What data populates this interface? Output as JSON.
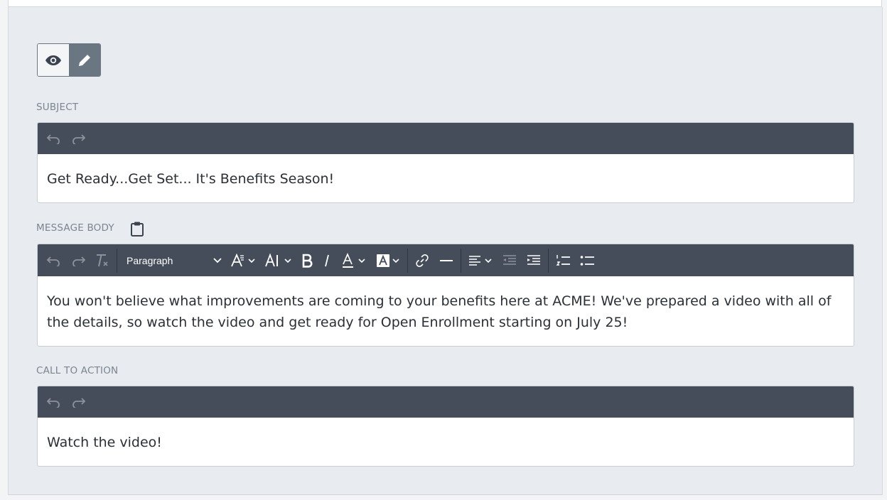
{
  "subject": {
    "label": "SUBJECT",
    "value": "Get Ready...Get Set... It's Benefits Season!"
  },
  "message_body": {
    "label": "MESSAGE BODY",
    "clipboard_icon": "clipboard-icon",
    "format_select": "Paragraph",
    "value": "You won't believe what improvements are coming to your benefits here at ACME! We've prepared a video with all of the details, so watch the video and get ready for Open Enrollment starting on July 25!"
  },
  "call_to_action": {
    "label": "CALL TO ACTION",
    "value": "Watch the video!"
  },
  "mode_toggle": {
    "options": [
      "preview",
      "edit"
    ],
    "active": "edit"
  },
  "colors": {
    "toolbar_bg": "#454d5a",
    "panel_bg": "#e8ebef",
    "label": "#7a8591",
    "toggle_active": "#6b7683"
  }
}
